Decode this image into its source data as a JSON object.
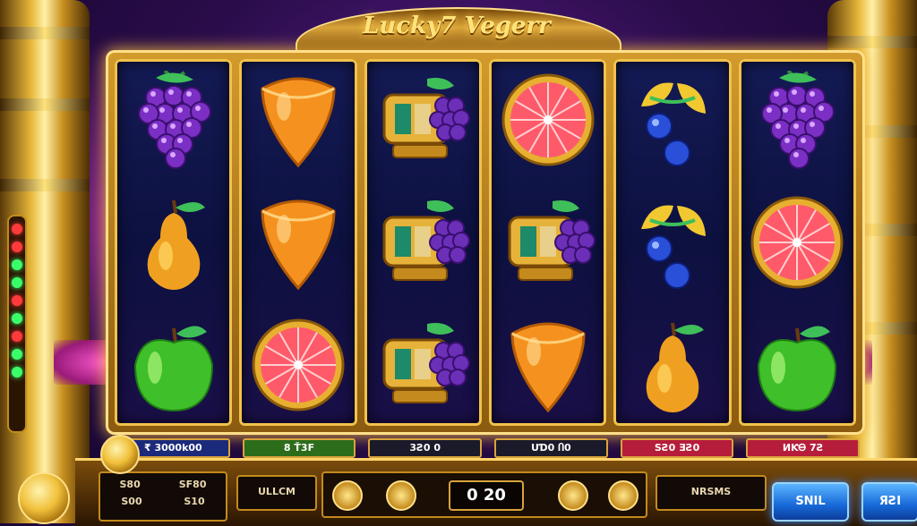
{
  "header": {
    "logo_text": "Lucky7 Vegerr"
  },
  "reels": [
    [
      "grapes",
      "pear",
      "apple"
    ],
    [
      "orange",
      "orange",
      "grapefruit"
    ],
    [
      "slot-machine-grapes",
      "slot-machine-grapes",
      "slot-machine-grapes"
    ],
    [
      "grapefruit",
      "slot-machine-grapes",
      "orange"
    ],
    [
      "lemon-blueberry",
      "lemon-blueberry",
      "pear"
    ],
    [
      "grapes",
      "grapefruit",
      "apple"
    ]
  ],
  "stakes": [
    "₹ 3000k00",
    "8 Ť3Ϝ",
    "3Ƨ0  0",
    "UƊ0 Ⴖ0",
    "SƧ0 ƎƧ0",
    "ИƘᎾ 7Ƨ"
  ],
  "console": {
    "left_row1": [
      "S80",
      "SF80"
    ],
    "left_row2": [
      "S00",
      "S10"
    ],
    "balance_label": "ULLCM",
    "center_value": "0 20",
    "nsms_label": "NRSMS",
    "spin_label": "SNIL",
    "bet_label": "ЯƧI"
  },
  "colors": {
    "accent_gold": "#f2c24a",
    "reel_bg": "#0d1140",
    "button_blue": "#1668d8"
  }
}
